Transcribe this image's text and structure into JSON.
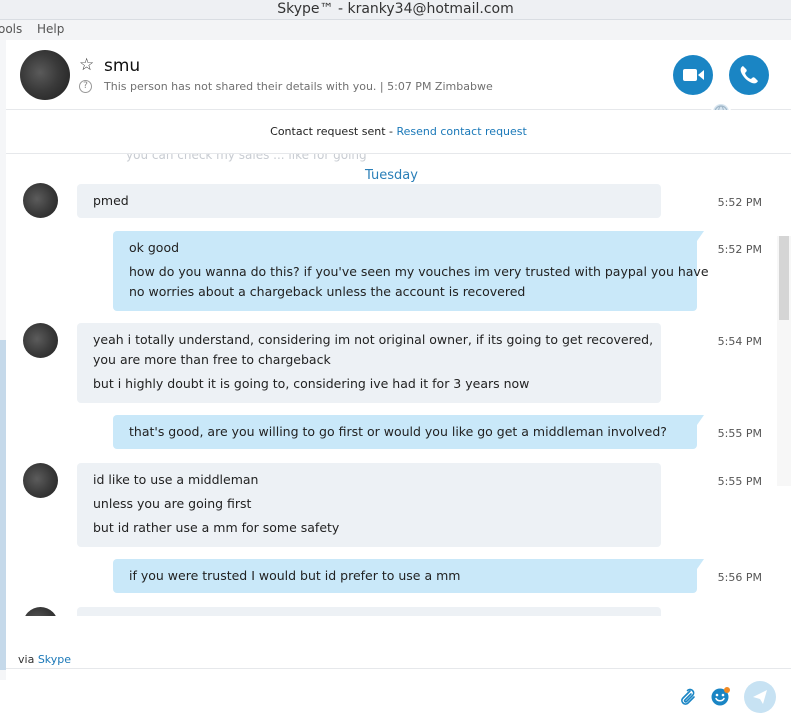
{
  "window": {
    "title": "Skype™ - kranky34@hotmail.com"
  },
  "menu": {
    "items": [
      "ools",
      "Help"
    ]
  },
  "header": {
    "contact_name": "smu",
    "status": "This person has not shared their details with you.  |  5:07 PM Zimbabwe"
  },
  "request": {
    "text": "Contact request sent - ",
    "link": "Resend contact request"
  },
  "chat": {
    "ghost_text": "you can check my sales ... like for going",
    "day_separator": "Tuesday",
    "messages": [
      {
        "dir": "in",
        "time": "5:52 PM",
        "lines": [
          "pmed"
        ]
      },
      {
        "dir": "out",
        "time": "5:52 PM",
        "lines": [
          "ok good",
          "how do you wanna do this? if you've seen my vouches im very trusted with paypal you have",
          "no worries about a chargeback unless the account is recovered"
        ]
      },
      {
        "dir": "in",
        "time": "5:54 PM",
        "lines": [
          "yeah i totally understand, considering im not original owner, if its going to get recovered,",
          "you are more than free to chargeback",
          "but i highly doubt it is going to, considering ive had it for 3 years now"
        ]
      },
      {
        "dir": "out",
        "time": "5:55 PM",
        "lines": [
          "that's good, are you willing to go first or would you like go get a middleman involved?"
        ]
      },
      {
        "dir": "in",
        "time": "5:55 PM",
        "lines": [
          "id like to use a middleman",
          "unless you are going first",
          "but id rather use a mm for some safety"
        ]
      },
      {
        "dir": "out",
        "time": "5:56 PM",
        "lines": [
          "if you were trusted I would but id prefer to use a mm"
        ]
      }
    ]
  },
  "compose": {
    "via_text": "via ",
    "via_link": "Skype"
  },
  "icons": {
    "favorite": "star-icon",
    "info": "question-icon",
    "video": "video-camera-icon",
    "call": "phone-icon",
    "globe": "globe-icon",
    "attach": "paperclip-icon",
    "emoji": "emoji-icon",
    "send": "send-icon"
  },
  "colors": {
    "accent": "#1a85c4",
    "link": "#1a78b8",
    "bubble_out": "#c9e8f9",
    "bubble_in": "#edf1f5"
  }
}
